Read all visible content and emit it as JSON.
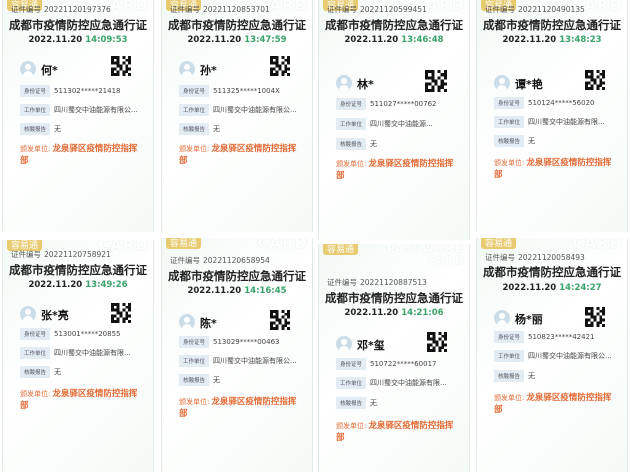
{
  "common": {
    "cert_label": "证件编号",
    "title": "成都市疫情防控应急通行证",
    "date": "2022.11.20",
    "id_label": "身份证号",
    "unit_label": "工作单位",
    "test_label": "核酸报告",
    "test_value": "无",
    "issuer_label": "颁发单位:",
    "issuer_l1": "龙泉驿区疫情防控指挥",
    "issuer_l2": "部",
    "tag": "容易通",
    "watermark_card": "CARD",
    "watermark_password": "PASSWORD",
    "accent_green": "#3aa36b",
    "accent_orange": "#e36a35"
  },
  "cards": [
    {
      "cert_no": "20221120197376",
      "time": "14:09:53",
      "name": "何*",
      "id_no": "511302*****21418",
      "unit": "四川蜀交中油能源有限公..."
    },
    {
      "cert_no": "20221120853701",
      "time": "13:47:59",
      "name": "孙*",
      "id_no": "511325*****1004X",
      "unit": "四川蜀交中油能源有限公..."
    },
    {
      "cert_no": "20221120599451",
      "time": "13:46:48",
      "name": "林*",
      "id_no": "511027*****00762",
      "unit": "四川蜀交中油能源..."
    },
    {
      "cert_no": "20221120490135",
      "time": "13:48:23",
      "name": "谭*艳",
      "id_no": "510124*****56020",
      "unit": "四川蜀交中油能源有限..."
    },
    {
      "cert_no": "20221120758921",
      "time": "13:49:26",
      "name": "张*亮",
      "id_no": "513001*****20855",
      "unit": "四川蜀交中油能源有限..."
    },
    {
      "cert_no": "20221120658954",
      "time": "14:16:45",
      "name": "陈*",
      "id_no": "513029*****00463",
      "unit": "四川蜀交中油能源有限公..."
    },
    {
      "cert_no": "20221120887513",
      "time": "14:21:06",
      "name": "邓*玺",
      "id_no": "510722*****60017",
      "unit": "四川蜀交中油能源有限..."
    },
    {
      "cert_no": "20221120058493",
      "time": "14:24:27",
      "name": "杨*丽",
      "id_no": "510823*****42421",
      "unit": "四川蜀交中油能源有限公..."
    }
  ]
}
